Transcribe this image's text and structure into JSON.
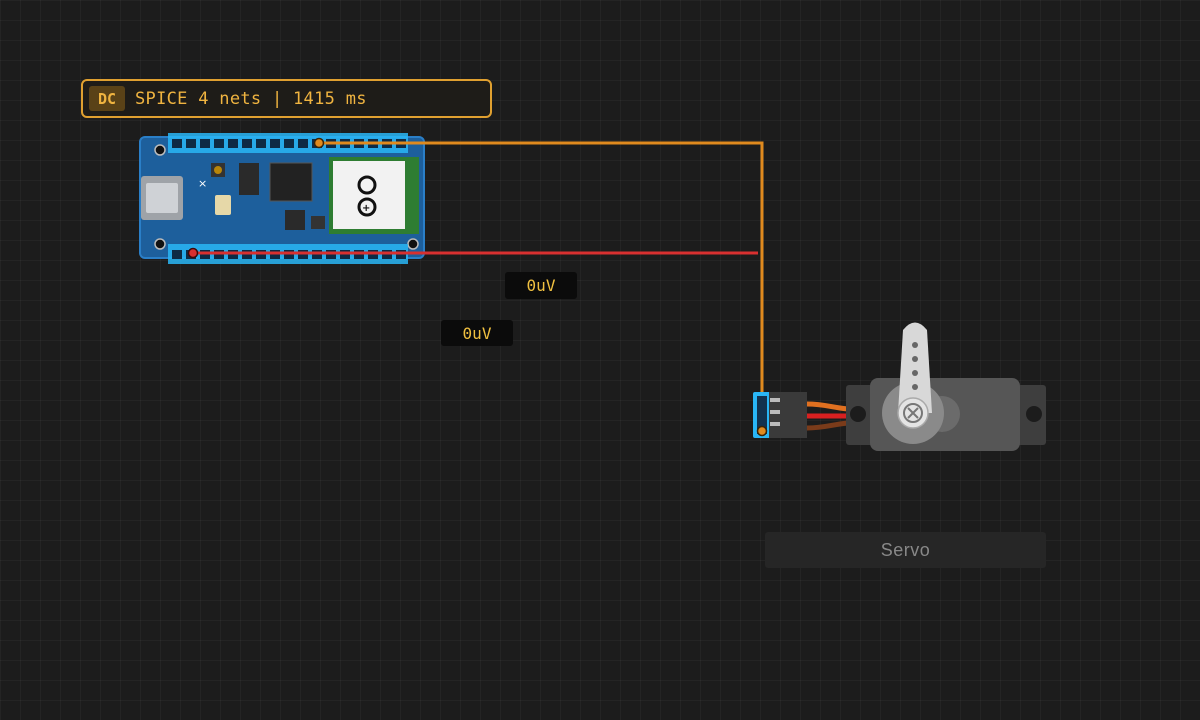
{
  "status_bar": {
    "mode_badge": "DC",
    "text": "SPICE 4 nets | 1415 ms"
  },
  "probes": [
    {
      "value": "0uV"
    },
    {
      "value": "0uV"
    }
  ],
  "components": {
    "board": {
      "icon": "arduino-infinity-logo"
    },
    "servo": {
      "label": "Servo"
    }
  },
  "wires": [
    {
      "color": "#e08a1e"
    },
    {
      "color": "#d83030"
    }
  ],
  "colors": {
    "accent": "#e0a030",
    "pin_highlight": "#29b6f6",
    "board_blue": "#1d5f9c",
    "probe_text": "#f0c040"
  }
}
